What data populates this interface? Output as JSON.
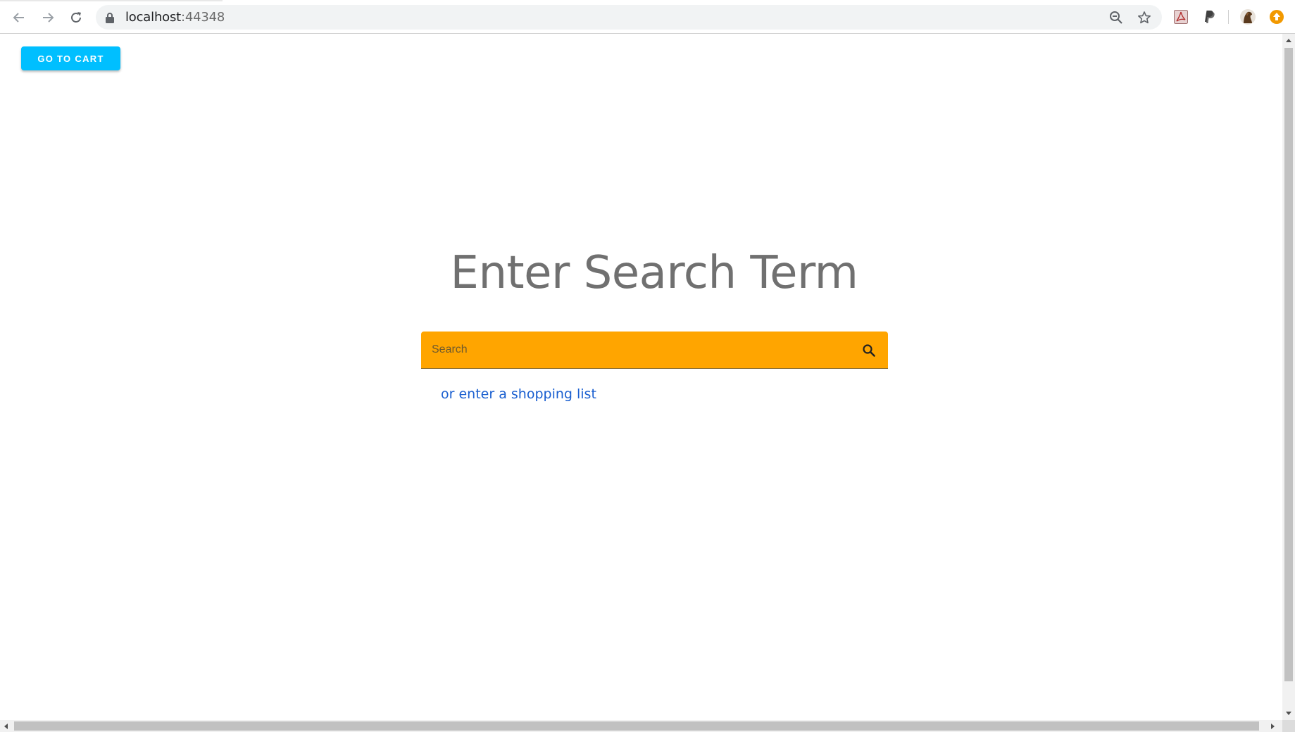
{
  "browser": {
    "url_host": "localhost",
    "url_port": ":44348",
    "icons": {
      "back": "arrow-left-icon",
      "forward": "arrow-right-icon",
      "reload": "reload-icon",
      "lock": "lock-icon",
      "zoom": "zoom-out-icon",
      "bookmark": "star-icon",
      "pdf_extension": "acrobat-icon",
      "paypal_extension": "paypal-icon",
      "profile": "avatar",
      "update": "update-icon"
    }
  },
  "page": {
    "cart_button_label": "GO TO CART",
    "title": "Enter Search Term",
    "search": {
      "placeholder": "Search",
      "value": ""
    },
    "shopping_list_link": "or enter a shopping list"
  },
  "colors": {
    "cart_button": "#00bfff",
    "search_bar": "#ffa500",
    "title_text": "#707070",
    "link": "#1a5fd0"
  }
}
